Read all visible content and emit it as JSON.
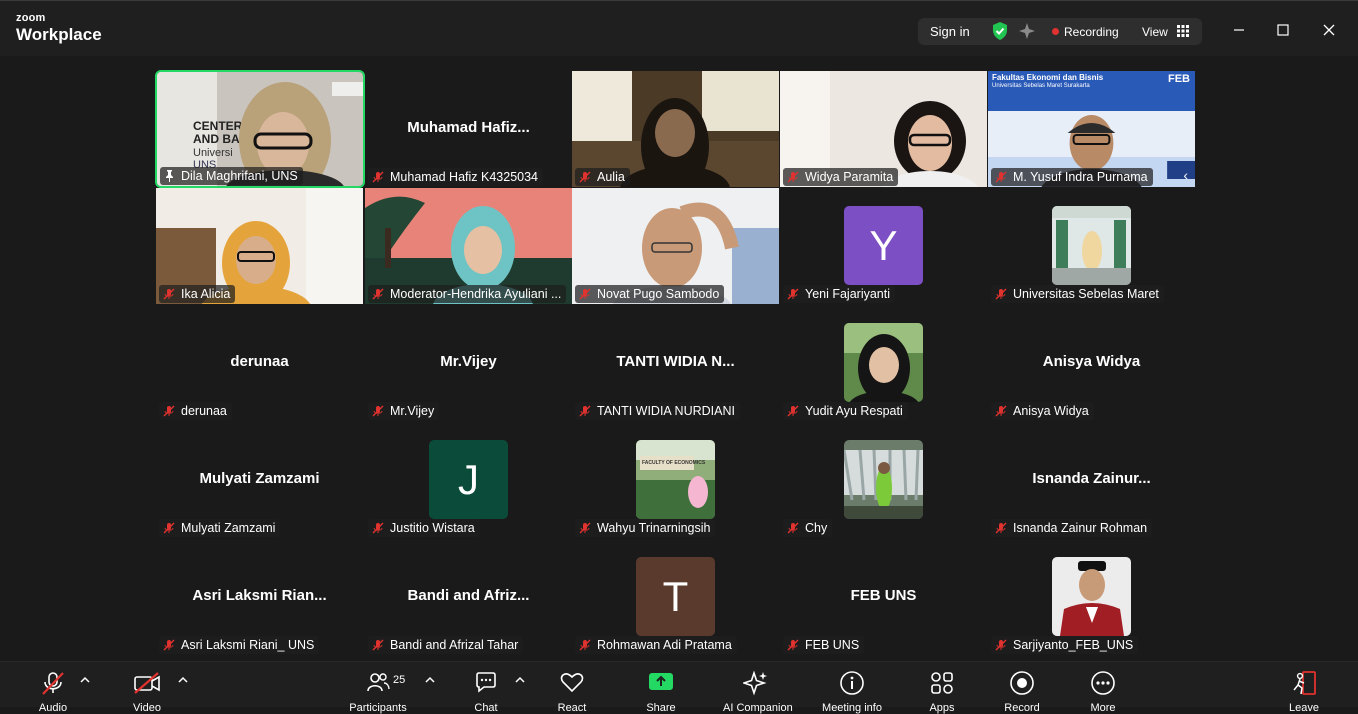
{
  "app": {
    "brand_top": "zoom",
    "brand_bottom": "Workplace"
  },
  "titlebar": {
    "sign_in": "Sign in",
    "recording": "Recording",
    "view": "View"
  },
  "colors": {
    "active_border": "#23d964",
    "recording_dot": "#e0322f",
    "share_green": "#23d964",
    "leave_red": "#e0322f"
  },
  "participants": [
    {
      "name": "Dila Maghrifani, UNS",
      "type": "video",
      "pinned": true,
      "active": true
    },
    {
      "name": "Muhamad Hafiz K4325034",
      "display": "Muhamad  Hafiz...",
      "type": "name"
    },
    {
      "name": "Aulia",
      "type": "video"
    },
    {
      "name": "Widya Paramita",
      "type": "video"
    },
    {
      "name": "M. Yusuf Indra Purnama",
      "type": "video",
      "banner_line1": "Fakultas Ekonomi dan Bisnis",
      "banner_line2": "Universitas Sebelas Maret Surakarta",
      "banner_logo": "FEB"
    },
    {
      "name": "Ika Alicia",
      "type": "video"
    },
    {
      "name": "Moderator-Hendrika Ayuliani ...",
      "type": "video"
    },
    {
      "name": "Novat Pugo Sambodo",
      "type": "video"
    },
    {
      "name": "Yeni Fajariyanti",
      "type": "avatar",
      "initial": "Y",
      "color": "#7c4fc4"
    },
    {
      "name": "Universitas Sebelas Maret",
      "type": "photo"
    },
    {
      "name": "derunaa",
      "display": "derunaa",
      "type": "name"
    },
    {
      "name": "Mr.Vijey",
      "display": "Mr.Vijey",
      "type": "name"
    },
    {
      "name": "TANTI WIDIA NURDIANI",
      "display": "TANTI WIDIA N...",
      "type": "name"
    },
    {
      "name": "Yudit Ayu Respati",
      "type": "photo"
    },
    {
      "name": "Anisya Widya",
      "display": "Anisya Widya",
      "type": "name"
    },
    {
      "name": "Mulyati Zamzami",
      "display": "Mulyati Zamzami",
      "type": "name"
    },
    {
      "name": "Justitio Wistara",
      "type": "avatar",
      "initial": "J",
      "color": "#0b4b3a"
    },
    {
      "name": "Wahyu Trinarningsih",
      "type": "photo",
      "sign": "FACULTY OF ECONOMICS"
    },
    {
      "name": "Chy",
      "type": "photo"
    },
    {
      "name": "Isnanda Zainur Rohman",
      "display": "Isnanda  Zainur...",
      "type": "name"
    },
    {
      "name": "Asri Laksmi Riani_ UNS",
      "display": "Asri Laksmi Rian...",
      "type": "name"
    },
    {
      "name": "Bandi and Afrizal Tahar",
      "display": "Bandi  and  Afriz...",
      "type": "name"
    },
    {
      "name": "Rohmawan Adi Pratama",
      "type": "avatar",
      "initial": "T",
      "color": "#5a3a2c"
    },
    {
      "name": "FEB UNS",
      "display": "FEB UNS",
      "type": "name"
    },
    {
      "name": "Sarjiyanto_FEB_UNS",
      "type": "photo"
    }
  ],
  "toolbar": {
    "audio": "Audio",
    "video": "Video",
    "participants": "Participants",
    "participants_count": "25",
    "chat": "Chat",
    "react": "React",
    "share": "Share",
    "ai_companion": "AI Companion",
    "meeting_info": "Meeting info",
    "apps": "Apps",
    "record": "Record",
    "more": "More",
    "leave": "Leave"
  }
}
